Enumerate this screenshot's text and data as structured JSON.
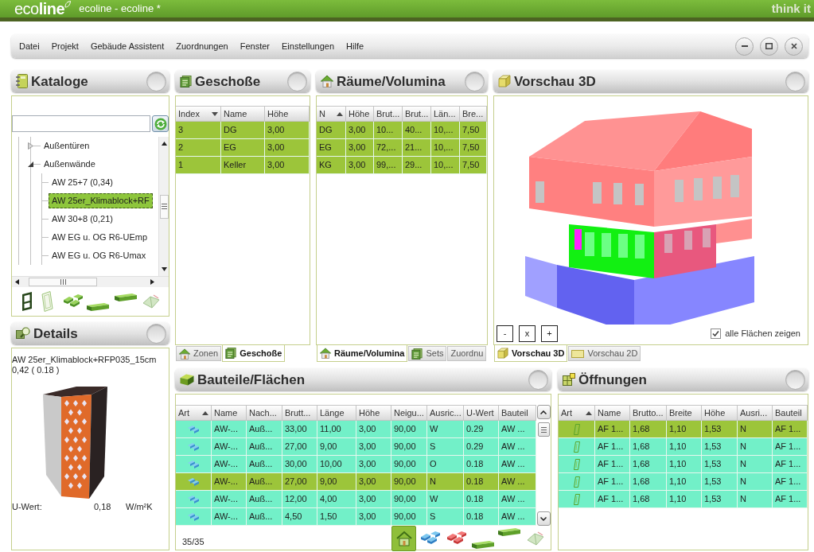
{
  "window": {
    "logo": "eco**line**",
    "title": "ecoline - ecoline *",
    "brand": "think it"
  },
  "menu": [
    "Datei",
    "Projekt",
    "Gebäude Assistent",
    "Zuordnungen",
    "Fenster",
    "Einstellungen",
    "Hilfe"
  ],
  "kataloge": {
    "title": "Kataloge",
    "tree": [
      {
        "label": "Außentüren",
        "expanded": false,
        "selected": false
      },
      {
        "label": "Außenwände",
        "expanded": true,
        "selected": false,
        "children": [
          {
            "label": "AW 25+7 (0,34)",
            "selected": false
          },
          {
            "label": "AW 25er_Klimablock+RF",
            "selected": true
          },
          {
            "label": "AW 30+8 (0,21)",
            "selected": false
          },
          {
            "label": "AW EG u. OG R6-UEmp",
            "selected": false
          },
          {
            "label": "AW EG u. OG R6-Umax",
            "selected": false
          }
        ]
      }
    ]
  },
  "details": {
    "title": "Details",
    "name": "AW 25er_Klimablock+RFP035_15cm",
    "values": "0,42 ( 0.18 )",
    "u_label": "U-Wert:",
    "u_value": "0,18",
    "u_unit": "W/m²K"
  },
  "geschosse": {
    "title": "Geschoße",
    "columns": [
      {
        "label": "Index",
        "sorted": true,
        "ascending": false
      },
      {
        "label": "Name"
      },
      {
        "label": "Höhe"
      }
    ],
    "rows": [
      {
        "selected": true,
        "cells": [
          "3",
          "DG",
          "3,00"
        ]
      },
      {
        "selected": true,
        "cells": [
          "2",
          "EG",
          "3,00"
        ]
      },
      {
        "selected": true,
        "cells": [
          "1",
          "Keller",
          "3,00"
        ]
      }
    ],
    "tabs": [
      {
        "label": "Zonen",
        "kind": "house",
        "selected": false
      },
      {
        "label": "Geschoße",
        "kind": "pages",
        "selected": true
      }
    ]
  },
  "raeume": {
    "title": "Räume/Volumina",
    "columns": [
      {
        "label": "N",
        "sorted": true,
        "ascending": true
      },
      {
        "label": "Höhe"
      },
      {
        "label": "Brut..."
      },
      {
        "label": "Brut..."
      },
      {
        "label": "Län..."
      },
      {
        "label": "Bre..."
      }
    ],
    "rows": [
      {
        "selected": true,
        "cells": [
          "DG",
          "3,00",
          "10...",
          "40...",
          "10,...",
          "7,50"
        ]
      },
      {
        "selected": true,
        "cells": [
          "EG",
          "3,00",
          "72,...",
          "21...",
          "10,...",
          "7,50"
        ]
      },
      {
        "selected": true,
        "cells": [
          "KG",
          "3,00",
          "99,...",
          "29...",
          "10,...",
          "7,50"
        ]
      }
    ],
    "tabs": [
      {
        "label": "Räume/Volumina",
        "kind": "house",
        "selected": true
      },
      {
        "label": "Sets",
        "kind": "pages",
        "selected": false
      },
      {
        "label": "Zuordnu",
        "kind": "plain",
        "selected": false
      }
    ]
  },
  "vorschau": {
    "title": "Vorschau 3D",
    "view_buttons": [
      "-",
      "x",
      "+"
    ],
    "show_all": {
      "label": "alle Flächen zeigen",
      "checked": true
    },
    "tabs": [
      {
        "label": "Vorschau 3D",
        "kind": "cube",
        "selected": true
      },
      {
        "label": "Vorschau 2D",
        "kind": "plan",
        "selected": false
      }
    ]
  },
  "bauteile": {
    "title": "Bauteile/Flächen",
    "columns": [
      {
        "label": "Art",
        "sorted": true,
        "ascending": true
      },
      {
        "label": "Name"
      },
      {
        "label": "Nach..."
      },
      {
        "label": "Brutt..."
      },
      {
        "label": "Länge"
      },
      {
        "label": "Höhe"
      },
      {
        "label": "Neigu..."
      },
      {
        "label": "Ausric..."
      },
      {
        "label": "U-Wert"
      },
      {
        "label": "Bauteil"
      }
    ],
    "rows": [
      {
        "kind": "wall",
        "selected": false,
        "cells": [
          "",
          "AW-...",
          "Auß...",
          "33,00",
          "11,00",
          "3,00",
          "90,00",
          "W",
          "0.29",
          "AW ..."
        ]
      },
      {
        "kind": "wall",
        "selected": false,
        "cells": [
          "",
          "AW-...",
          "Auß...",
          "27,00",
          "9,00",
          "3,00",
          "90,00",
          "S",
          "0.29",
          "AW ..."
        ]
      },
      {
        "kind": "wall",
        "selected": false,
        "cells": [
          "",
          "AW-...",
          "Auß...",
          "30,00",
          "10,00",
          "3,00",
          "90,00",
          "O",
          "0.18",
          "AW ..."
        ]
      },
      {
        "kind": "wall",
        "selected": true,
        "cells": [
          "",
          "AW-...",
          "Auß...",
          "27,00",
          "9,00",
          "3,00",
          "90,00",
          "N",
          "0.18",
          "AW ..."
        ]
      },
      {
        "kind": "wall",
        "selected": false,
        "cells": [
          "",
          "AW-...",
          "Auß...",
          "12,00",
          "4,00",
          "3,00",
          "90,00",
          "W",
          "0.18",
          "AW ..."
        ]
      },
      {
        "kind": "wall",
        "selected": false,
        "cells": [
          "",
          "AW-...",
          "Auß...",
          "4,50",
          "1,50",
          "3,00",
          "90,00",
          "S",
          "0.18",
          "AW ..."
        ]
      }
    ],
    "count": "35/35",
    "toolbar": [
      {
        "kind": "house",
        "selected": true
      },
      {
        "kind": "blue-bricks",
        "selected": false
      },
      {
        "kind": "red-bricks",
        "selected": false
      },
      {
        "kind": "slab-low",
        "selected": false
      },
      {
        "kind": "slab-high",
        "selected": false
      },
      {
        "kind": "roof",
        "selected": false
      }
    ]
  },
  "oeffnungen": {
    "title": "Öffnungen",
    "columns": [
      {
        "label": "Art",
        "sorted": true,
        "ascending": true
      },
      {
        "label": "Name"
      },
      {
        "label": "Brutto..."
      },
      {
        "label": "Breite"
      },
      {
        "label": "Höhe"
      },
      {
        "label": "Ausri..."
      },
      {
        "label": "Bauteil"
      }
    ],
    "rows": [
      {
        "kind": "window",
        "selected": true,
        "cells": [
          "",
          "AF 1...",
          "1,68",
          "1,10",
          "1,53",
          "N",
          "AF 1..."
        ]
      },
      {
        "kind": "window",
        "selected": false,
        "cells": [
          "",
          "AF 1...",
          "1,68",
          "1,10",
          "1,53",
          "N",
          "AF 1..."
        ]
      },
      {
        "kind": "window",
        "selected": false,
        "cells": [
          "",
          "AF 1...",
          "1,68",
          "1,10",
          "1,53",
          "N",
          "AF 1..."
        ]
      },
      {
        "kind": "window",
        "selected": false,
        "cells": [
          "",
          "AF 1...",
          "1,68",
          "1,10",
          "1,53",
          "N",
          "AF 1..."
        ]
      },
      {
        "kind": "window",
        "selected": false,
        "cells": [
          "",
          "AF 1...",
          "1,68",
          "1,10",
          "1,53",
          "N",
          "AF 1..."
        ]
      }
    ]
  }
}
